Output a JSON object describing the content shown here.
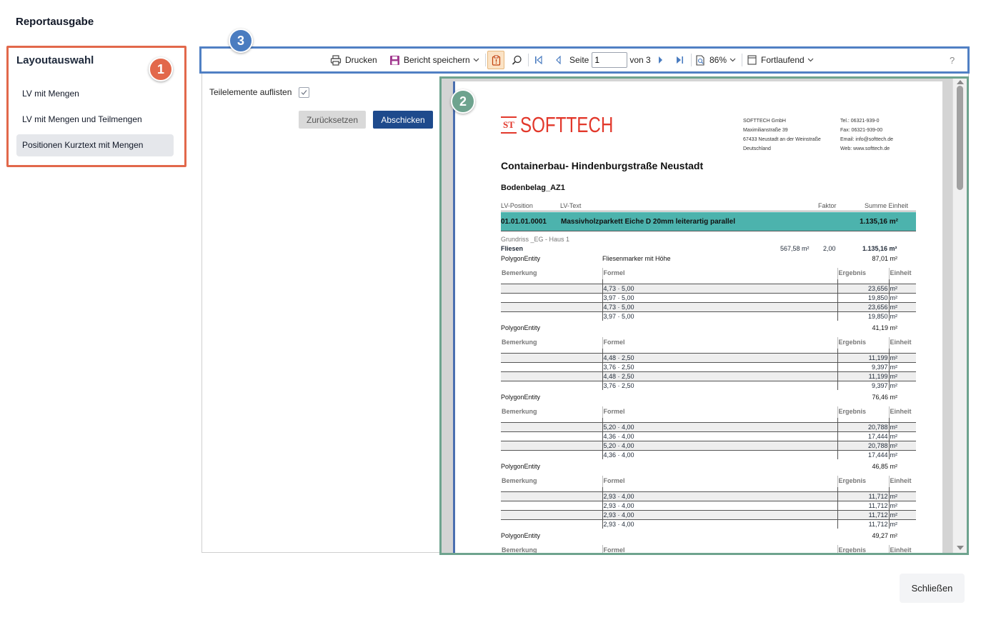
{
  "dialog": {
    "title": "Reportausgabe",
    "close_label": "Schließen"
  },
  "badges": {
    "one": "1",
    "two": "2",
    "three": "3"
  },
  "colors": {
    "badge1": "#e2684b",
    "badge2": "#6ea38e",
    "badge3": "#4a7cc0",
    "accent": "#1e4a8c",
    "position_bar": "#4cb3ad",
    "logo": "#e2382b"
  },
  "layout": {
    "heading": "Layoutauswahl",
    "items": [
      {
        "label": "LV mit Mengen"
      },
      {
        "label": "LV mit Mengen und Teilmengen"
      },
      {
        "label": "Positionen Kurztext mit Mengen"
      }
    ],
    "selected": "Positionen Kurztext mit Mengen"
  },
  "options": {
    "list_subelements_label": "Teilelemente auflisten",
    "list_subelements_checked": true,
    "reset_label": "Zurücksetzen",
    "submit_label": "Abschicken"
  },
  "toolbar": {
    "print_label": "Drucken",
    "save_label": "Bericht speichern",
    "page_label": "Seite",
    "page_value": "1",
    "page_total": "von 3",
    "zoom": "86%",
    "view_mode": "Fortlaufend",
    "help": "?",
    "icons": [
      "printer-icon",
      "save-icon",
      "clipboard-icon",
      "search-icon",
      "first-page-icon",
      "previous-page-icon",
      "next-page-icon",
      "last-page-icon",
      "zoom-icon",
      "view-mode-icon"
    ]
  },
  "report": {
    "logo_mark": "ST",
    "logo_text": "SOFTTECH",
    "company": [
      "SOFTTECH GmbH",
      "Maximilianstraße 39",
      "67433 Neustadt an der Weinstraße",
      "Deutschland"
    ],
    "contact": [
      "Tel.: 06321-939-0",
      "Fax: 06321-939-00",
      "Email: info@softtech.de",
      "Web: www.softtech.de"
    ],
    "title": "Containerbau- Hindenburgstraße Neustadt",
    "subtitle": "Bodenbelag_AZ1",
    "columns": {
      "lv_position": "LV-Position",
      "lv_text": "LV-Text",
      "factor": "Faktor",
      "sum_unit": "Summe Einheit"
    },
    "position": {
      "number": "01.01.01.0001",
      "text": "Massivholzparkett Eiche D 20mm leiterartig parallel",
      "sum": "1.135,16 m²"
    },
    "area": {
      "label": "Grundriss _EG - Haus 1",
      "name": "Fliesen",
      "quantity": "567,58 m²",
      "factor": "2,00",
      "sum": "1.135,16 m²"
    },
    "measure_headers": {
      "remark": "Bemerkung",
      "formula": "Formel",
      "result": "Ergebnis",
      "unit": "Einheit"
    },
    "entities": [
      {
        "name": "PolygonEntity",
        "desc": "Fliesenmarker mit Höhe",
        "total": "87,01 m²",
        "rows": [
          {
            "formula": "4,73 · 5,00",
            "result": "23,656",
            "unit": "m²"
          },
          {
            "formula": "3,97 · 5,00",
            "result": "19,850",
            "unit": "m²"
          },
          {
            "formula": "4,73 · 5,00",
            "result": "23,656",
            "unit": "m²"
          },
          {
            "formula": "3,97 · 5,00",
            "result": "19,850",
            "unit": "m²"
          }
        ]
      },
      {
        "name": "PolygonEntity",
        "desc": "",
        "total": "41,19 m²",
        "rows": [
          {
            "formula": "4,48 · 2,50",
            "result": "11,199",
            "unit": "m²"
          },
          {
            "formula": "3,76 · 2,50",
            "result": "9,397",
            "unit": "m²"
          },
          {
            "formula": "4,48 · 2,50",
            "result": "11,199",
            "unit": "m²"
          },
          {
            "formula": "3,76 · 2,50",
            "result": "9,397",
            "unit": "m²"
          }
        ]
      },
      {
        "name": "PolygonEntity",
        "desc": "",
        "total": "76,46 m²",
        "rows": [
          {
            "formula": "5,20 · 4,00",
            "result": "20,788",
            "unit": "m²"
          },
          {
            "formula": "4,36 · 4,00",
            "result": "17,444",
            "unit": "m²"
          },
          {
            "formula": "5,20 · 4,00",
            "result": "20,788",
            "unit": "m²"
          },
          {
            "formula": "4,36 · 4,00",
            "result": "17,444",
            "unit": "m²"
          }
        ]
      },
      {
        "name": "PolygonEntity",
        "desc": "",
        "total": "46,85 m²",
        "rows": [
          {
            "formula": "2,93 · 4,00",
            "result": "11,712",
            "unit": "m²"
          },
          {
            "formula": "2,93 · 4,00",
            "result": "11,712",
            "unit": "m²"
          },
          {
            "formula": "2,93 · 4,00",
            "result": "11,712",
            "unit": "m²"
          },
          {
            "formula": "2,93 · 4,00",
            "result": "11,712",
            "unit": "m²"
          }
        ]
      },
      {
        "name": "PolygonEntity",
        "desc": "",
        "total": "49,27 m²",
        "rows": []
      }
    ]
  }
}
